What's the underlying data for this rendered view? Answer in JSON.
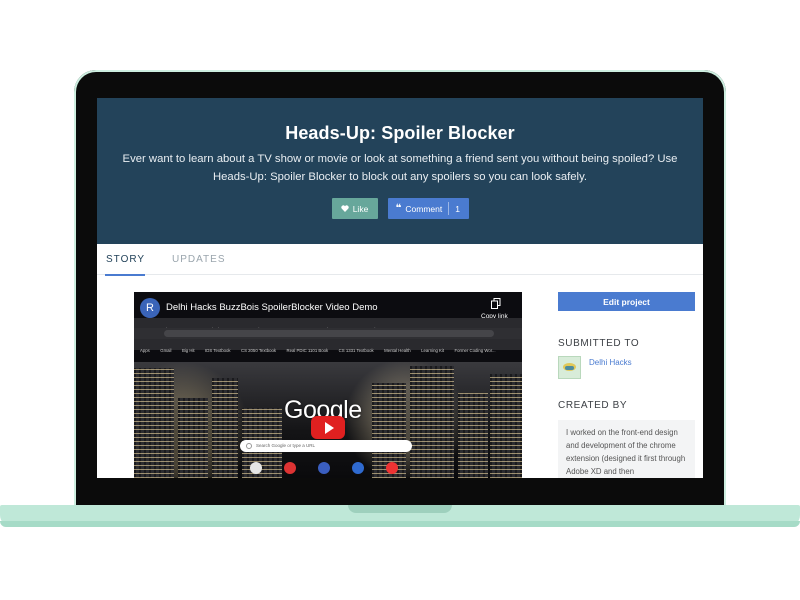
{
  "hero": {
    "title": "Heads-Up: Spoiler Blocker",
    "description": "Ever want to learn about a TV show or movie or look at something a friend sent you without being spoiled? Use Heads-Up: Spoiler Blocker to block out any spoilers so you can look safely.",
    "like_label": "Like",
    "comment_label": "Comment",
    "comment_count": "1"
  },
  "tabs": [
    {
      "label": "STORY",
      "active": true
    },
    {
      "label": "UPDATES",
      "active": false
    }
  ],
  "video": {
    "avatar_letter": "R",
    "title": "Delhi Hacks BuzzBois SpoilerBlocker Video Demo",
    "copy_link_label": "Copy link",
    "browser_tabs": [
      "Enter",
      "About",
      "Vercx",
      "Slack",
      "Nam",
      "Uplo",
      "My C",
      "Devp",
      "Head",
      "Goo",
      "New Tab"
    ],
    "bookmarks": [
      "Apps",
      "Gmail",
      "Big Hit",
      "IDS Textbook",
      "CS 2050 Textbook",
      "Real PDIC 1101 Book",
      "CS 1331 Textbook",
      "Mental Health",
      "Learning Kit",
      "Former Coding Wor..."
    ],
    "google_logo": "Google",
    "search_placeholder": "Search Google or type a URL"
  },
  "sidebar": {
    "edit_button": "Edit project",
    "submitted_heading": "SUBMITTED TO",
    "hackathon_name": "Delhi Hacks",
    "created_heading": "CREATED BY",
    "created_text": "I worked on the front-end design and development of the chrome extension (designed it first through Adobe XD and then"
  },
  "colors": {
    "hero_bg": "#23435a",
    "accent_blue": "#4a7bd0",
    "like_green": "#67a79b",
    "laptop_mint": "#bfe8d8"
  }
}
